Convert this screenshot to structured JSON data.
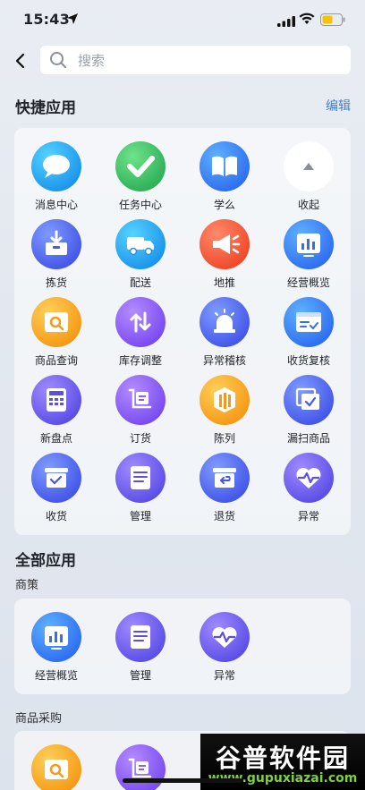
{
  "status_bar": {
    "time": "15:43"
  },
  "search": {
    "placeholder": "搜索"
  },
  "quick": {
    "title": "快捷应用",
    "edit_label": "编辑",
    "items": [
      {
        "label": "消息中心",
        "icon": "message-icon"
      },
      {
        "label": "任务中心",
        "icon": "check-icon"
      },
      {
        "label": "学么",
        "icon": "book-icon"
      },
      {
        "label": "收起",
        "icon": "collapse-icon"
      },
      {
        "label": "拣货",
        "icon": "pick-box-icon"
      },
      {
        "label": "配送",
        "icon": "truck-icon"
      },
      {
        "label": "地推",
        "icon": "megaphone-icon"
      },
      {
        "label": "经营概览",
        "icon": "chart-icon"
      },
      {
        "label": "商品查询",
        "icon": "product-search-icon"
      },
      {
        "label": "库存调整",
        "icon": "stock-adjust-icon"
      },
      {
        "label": "异常稽核",
        "icon": "alarm-icon"
      },
      {
        "label": "收货复核",
        "icon": "receipt-check-icon"
      },
      {
        "label": "新盘点",
        "icon": "calculator-icon"
      },
      {
        "label": "订货",
        "icon": "cart-icon"
      },
      {
        "label": "陈列",
        "icon": "display-icon"
      },
      {
        "label": "漏扫商品",
        "icon": "missed-scan-icon"
      },
      {
        "label": "收货",
        "icon": "receive-icon"
      },
      {
        "label": "管理",
        "icon": "document-icon"
      },
      {
        "label": "退货",
        "icon": "return-icon"
      },
      {
        "label": "异常",
        "icon": "pulse-icon"
      }
    ]
  },
  "all_apps": {
    "title": "全部应用",
    "sections": [
      {
        "title": "商策",
        "items": [
          {
            "label": "经营概览",
            "icon": "chart-icon"
          },
          {
            "label": "管理",
            "icon": "document-icon"
          },
          {
            "label": "异常",
            "icon": "pulse-icon"
          }
        ]
      },
      {
        "title": "商品采购",
        "items": [
          {
            "label": "",
            "icon": "product-search-icon"
          },
          {
            "label": "",
            "icon": "cart-icon"
          }
        ]
      }
    ]
  },
  "watermark": {
    "main": "谷普软件园",
    "sub": "www.gupuxiazai.com"
  }
}
